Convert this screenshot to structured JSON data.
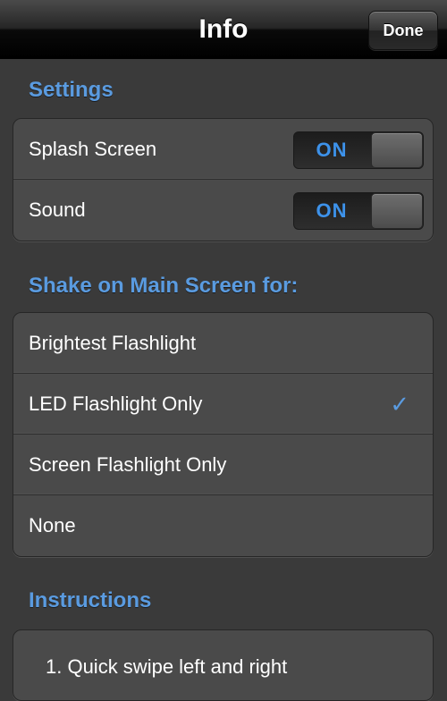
{
  "navbar": {
    "title": "Info",
    "done_label": "Done"
  },
  "settings": {
    "header": "Settings",
    "rows": [
      {
        "label": "Splash Screen",
        "toggle_label": "ON",
        "on": true
      },
      {
        "label": "Sound",
        "toggle_label": "ON",
        "on": true
      }
    ]
  },
  "shake": {
    "header": "Shake on Main Screen for:",
    "options": [
      {
        "label": "Brightest Flashlight",
        "selected": false
      },
      {
        "label": "LED Flashlight Only",
        "selected": true
      },
      {
        "label": "Screen Flashlight Only",
        "selected": false
      },
      {
        "label": "None",
        "selected": false
      }
    ],
    "check_glyph": "✓"
  },
  "instructions": {
    "header": "Instructions",
    "text": "1. Quick swipe left and right"
  },
  "colors": {
    "accent": "#5a9be0",
    "toggle_on": "#3d92ea",
    "background": "#3a3a3a",
    "cell": "#4a4a4a"
  }
}
